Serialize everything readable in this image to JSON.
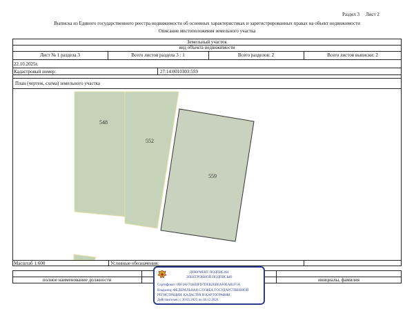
{
  "header": {
    "section": "Раздел 3",
    "sheet": "Лист 2",
    "title": "Выписка из Единого государственного реестра недвижимости об основных характеристиках и зарегистрированных правах на объект недвижимости",
    "subtitle": "Описание местоположения земельного участка"
  },
  "object": {
    "name": "Земельный участок",
    "caption": "вид объекта недвижимости"
  },
  "sheet_info": {
    "sheet_no": "Лист № 1 раздела 3",
    "total_section": "Всего листов раздела 3 : 1",
    "total_sections": "Всего разделов: 2",
    "total_sheets": "Всего листов выписки: 2"
  },
  "date": "22.10.2025г.",
  "cadastral": {
    "label": "Кадастровый номер:",
    "value": "27:14:0010303:559"
  },
  "plan": {
    "title": "План (чертеж, схема) земельного участка",
    "parcels": [
      "548",
      "552",
      "559"
    ],
    "colors": {
      "neighbor_fill": "#c5d4b9",
      "neighbor_border": "#e8e0a8",
      "target_fill": "#c9d2bf",
      "target_border": "#333333"
    }
  },
  "footer": {
    "scale": "Масштаб 1:600",
    "legend": "Условные обозначения:",
    "position_caption": "полное наименование должности",
    "signature_caption": "инициалы, фамилия"
  },
  "stamp": {
    "line1": "ДОКУМЕНТ ПОДПИСАН",
    "line2": "ЭЛЕКТРОННОЙ ПОДПИСЬЮ",
    "certificate": "Сертификат: 00F1AF74AE0FD7DEB2EBEAF0EAB1F3A",
    "owner_line1": "Владелец: ФЕДЕРАЛЬНАЯ СЛУЖБА ГОСУДАРСТВЕННОЙ",
    "owner_line2": "РЕГИСТРАЦИИ, КАДАСТРА И КАРТОГРАФИИ",
    "validity": "Действителен: с 30.05.2025 по 18.12.2026",
    "emblem_icon": "coat-of-arms-icon",
    "border_color": "#2b3a8f"
  }
}
